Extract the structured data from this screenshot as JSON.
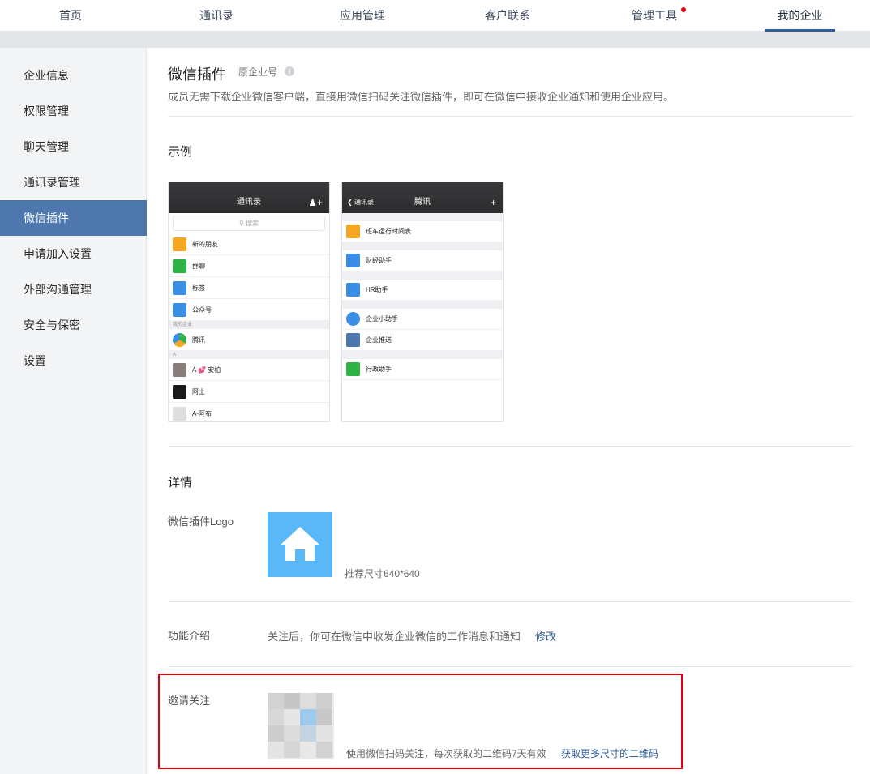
{
  "nav": {
    "tabs": [
      {
        "label": "首页"
      },
      {
        "label": "通讯录"
      },
      {
        "label": "应用管理"
      },
      {
        "label": "客户联系"
      },
      {
        "label": "管理工具"
      },
      {
        "label": "我的企业"
      }
    ],
    "active": "我的企业",
    "notification_dot_on": "管理工具"
  },
  "sidebar": {
    "items": [
      {
        "label": "企业信息"
      },
      {
        "label": "权限管理"
      },
      {
        "label": "聊天管理"
      },
      {
        "label": "通讯录管理"
      },
      {
        "label": "微信插件"
      },
      {
        "label": "申请加入设置"
      },
      {
        "label": "外部沟通管理"
      },
      {
        "label": "安全与保密"
      },
      {
        "label": "设置"
      }
    ],
    "active": "微信插件"
  },
  "main": {
    "title": "微信插件",
    "subtitle": "原企业号",
    "description": "成员无需下载企业微信客户端，直接用微信扫码关注微信插件，即可在微信中接收企业通知和使用企业应用。",
    "example_title": "示例",
    "phone1": {
      "title": "通讯录",
      "search_placeholder": "搜索",
      "rows": [
        "新的朋友",
        "群聊",
        "标签",
        "公众号"
      ],
      "group1": "我的企业",
      "company": "腾讯",
      "group2": "A",
      "contacts": [
        "A 💕 安柏",
        "阿土",
        "A-阿布"
      ]
    },
    "phone2": {
      "back": "通讯录",
      "title": "腾讯",
      "plus": "+",
      "rows": [
        "班车运行时间表",
        "财经助手",
        "HR助手",
        "企业小助手",
        "企业推送",
        "行政助手"
      ]
    },
    "details_title": "详情",
    "logo_label": "微信插件Logo",
    "logo_hint": "推荐尺寸640*640",
    "intro_label": "功能介绍",
    "intro_text": "关注后，你可在微信中收发企业微信的工作消息和通知",
    "intro_edit": "修改",
    "invite_label": "邀请关注",
    "invite_hint": "使用微信扫码关注，每次获取的二维码7天有效",
    "invite_link": "获取更多尺寸的二维码"
  },
  "colors": {
    "accent": "#2f5d97",
    "sidebar_active": "#4e78ad",
    "logo_bg": "#5ab7f8",
    "highlight_border": "#e0000b",
    "notification_dot": "#e60012"
  }
}
